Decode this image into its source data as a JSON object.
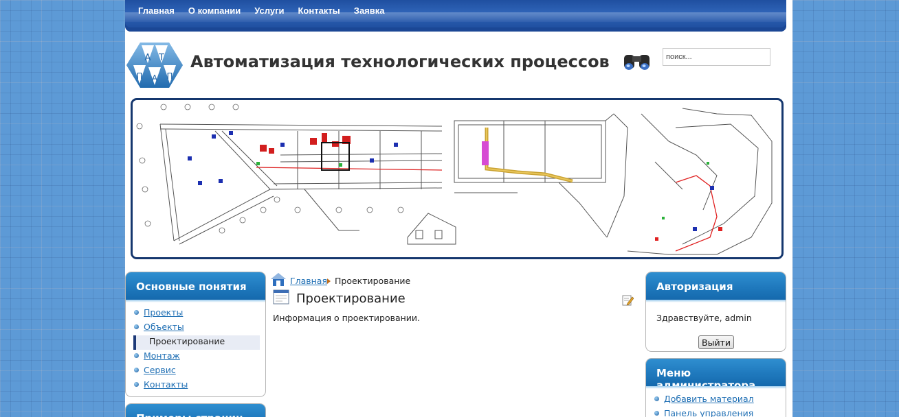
{
  "nav": {
    "items": [
      "Главная",
      "О компании",
      "Услуги",
      "Контакты",
      "Заявка"
    ]
  },
  "header": {
    "logo_letters": [
      "А",
      "Т",
      "П",
      "А",
      "П"
    ],
    "title": "Автоматизация технологических процессов",
    "search_value": "поиск..."
  },
  "left_menu": {
    "title": "Основные понятия",
    "items": [
      {
        "label": "Проекты",
        "active": false
      },
      {
        "label": "Объекты",
        "active": false
      },
      {
        "label": "Проектирование",
        "active": true
      },
      {
        "label": "Монтаж",
        "active": false
      },
      {
        "label": "Сервис",
        "active": false
      },
      {
        "label": "Контакты",
        "active": false
      }
    ]
  },
  "left_module2": {
    "title": "Примеры страниц"
  },
  "breadcrumb": {
    "home": "Главная",
    "current": "Проектирование"
  },
  "article": {
    "title": "Проектирование",
    "text": "Информация о проектировании."
  },
  "auth": {
    "title": "Авторизация",
    "greeting": "Здравствуйте, admin",
    "logout": "Выйти"
  },
  "admin_menu": {
    "title": "Меню администратора",
    "items": [
      "Добавить материал",
      "Панель управления"
    ]
  },
  "colors": {
    "nav_blue": "#1f4fa0",
    "module_header": "#1f79bd",
    "link": "#1f6fb4",
    "banner_border": "#15376e"
  }
}
